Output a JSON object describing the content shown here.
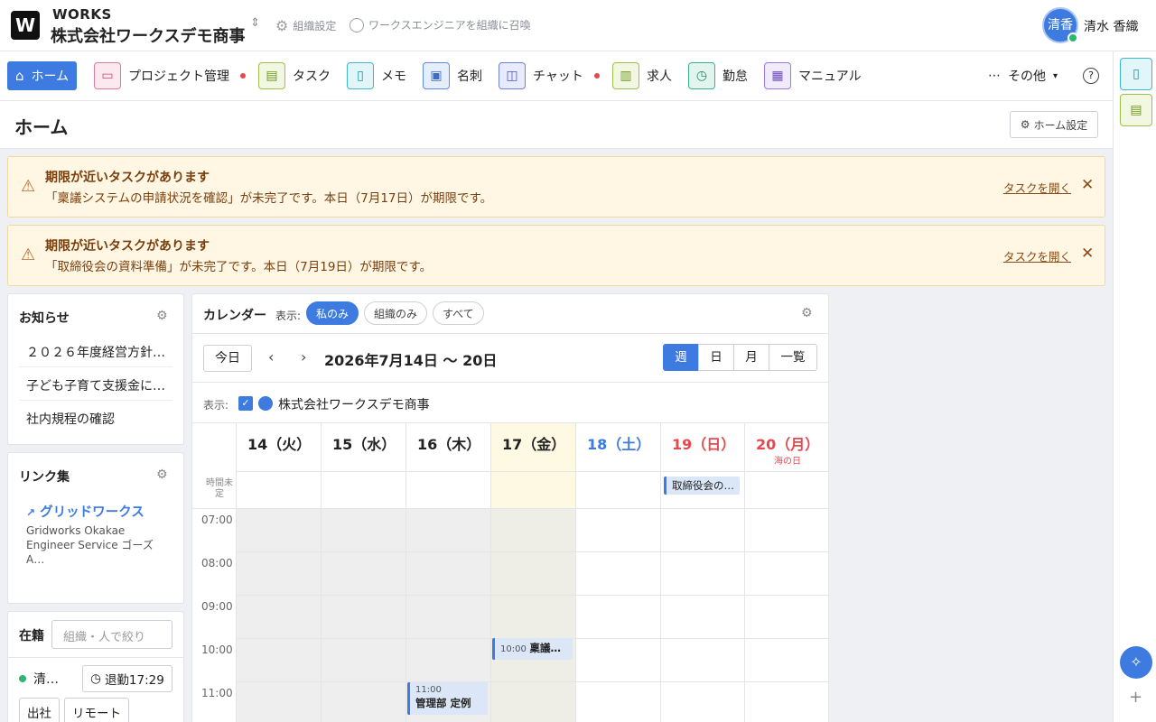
{
  "header": {
    "logo_letter": "W",
    "brand": "WORKS",
    "org_name": "株式会社ワークスデモ商事",
    "org_settings": "組織設定",
    "invite": "ワークスエンジニアを組織に召喚",
    "avatar_text": "清香",
    "user_name": "清水 香織"
  },
  "nav": {
    "items": [
      {
        "label": "ホーム"
      },
      {
        "label": "プロジェクト管理"
      },
      {
        "label": "タスク"
      },
      {
        "label": "メモ"
      },
      {
        "label": "名刺"
      },
      {
        "label": "チャット"
      },
      {
        "label": "求人"
      },
      {
        "label": "勤怠"
      },
      {
        "label": "マニュアル"
      }
    ],
    "more": "その他",
    "help": "?"
  },
  "page": {
    "title": "ホーム",
    "settings_button": "ホーム設定"
  },
  "alerts": [
    {
      "title": "期限が近いタスクがあります",
      "body": "「稟議システムの申請状況を確認」が未完了です。本日（7月17日）が期限です。",
      "link": "タスクを開く"
    },
    {
      "title": "期限が近いタスクがあります",
      "body": "「取締役会の資料準備」が未完了です。本日（7月19日）が期限です。",
      "link": "タスクを開く"
    }
  ],
  "notices": {
    "title": "お知らせ",
    "items": [
      "２０２６年度経営方針…",
      "子ども子育て支援金に…",
      "社内規程の確認"
    ]
  },
  "links": {
    "title": "リンク集",
    "item_title": "グリッドワークス",
    "item_desc": "Gridworks Okakae Engineer Service ゴーズA…"
  },
  "presence": {
    "title": "在籍",
    "filter_placeholder": "組織・人で絞り",
    "name": "清…",
    "leave_label": "退勤17:29",
    "buttons": [
      "出社",
      "リモート"
    ]
  },
  "calendar": {
    "title": "カレンダー",
    "show_label": "表示:",
    "filters": [
      "私のみ",
      "組織のみ",
      "すべて"
    ],
    "today": "今日",
    "range": "2026年7月14日 〜 20日",
    "views": [
      "週",
      "日",
      "月",
      "一覧"
    ],
    "org_label": "表示:",
    "org_name": "株式会社ワークスデモ商事",
    "allday_label": "時間未定",
    "days": [
      {
        "label": "14（火）",
        "color": "#222222",
        "sub": ""
      },
      {
        "label": "15（水）",
        "color": "#222222",
        "sub": ""
      },
      {
        "label": "16（木）",
        "color": "#222222",
        "sub": ""
      },
      {
        "label": "17（金）",
        "color": "#222222",
        "sub": ""
      },
      {
        "label": "18（土）",
        "color": "#3d7be0",
        "sub": ""
      },
      {
        "label": "19（日）",
        "color": "#e5484d",
        "sub": ""
      },
      {
        "label": "20（月）",
        "color": "#e5484d",
        "sub": "海の日"
      }
    ],
    "hours": [
      "07:00",
      "08:00",
      "09:00",
      "10:00",
      "11:00"
    ],
    "events": {
      "allday": "取締役会の…",
      "e1_time": "10:00",
      "e1_title": "稟議…",
      "e2_time": "11:00",
      "e2_title": "管理部 定例"
    }
  },
  "colors": {
    "accent": "#3d7be0",
    "alert_bg": "#fff7e3",
    "today_bg": "#fdf9e3"
  }
}
